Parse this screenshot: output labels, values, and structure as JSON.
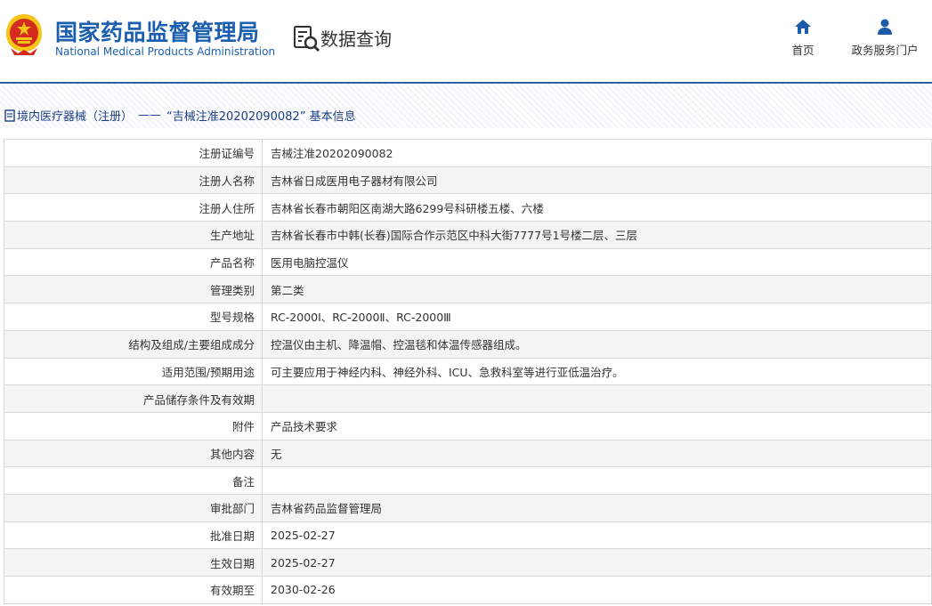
{
  "header": {
    "agency_cn": "国家药品监督管理局",
    "agency_en": "National Medical Products Administration",
    "section_title": "数据查询",
    "nav": {
      "home": "首页",
      "portal": "政务服务门户"
    }
  },
  "breadcrumb": {
    "category": "境内医疗器械（注册）",
    "separator": "——",
    "current": "“吉械注准20202090082” 基本信息"
  },
  "colors": {
    "brand_blue": "#1b5fae",
    "nav_icon_blue": "#1a5aa8",
    "rule_blue": "#2b63a8",
    "emblem_red": "#d52b1e",
    "emblem_gold": "#f5c518"
  },
  "icons": {
    "emblem": "national-emblem-icon",
    "query": "data-query-icon",
    "home": "home-icon",
    "portal": "user-icon",
    "doc": "document-icon"
  },
  "record": [
    {
      "label": "注册证编号",
      "value": "吉械注准20202090082"
    },
    {
      "label": "注册人名称",
      "value": "吉林省日成医用电子器材有限公司"
    },
    {
      "label": "注册人住所",
      "value": "吉林省长春市朝阳区南湖大路6299号科研楼五楼、六楼"
    },
    {
      "label": "生产地址",
      "value": "吉林省长春市中韩(长春)国际合作示范区中科大街7777号1号楼二层、三层"
    },
    {
      "label": "产品名称",
      "value": "医用电脑控温仪"
    },
    {
      "label": "管理类别",
      "value": "第二类"
    },
    {
      "label": "型号规格",
      "value": "RC-2000Ⅰ、RC-2000Ⅱ、RC-2000Ⅲ"
    },
    {
      "label": "结构及组成/主要组成成分",
      "value": "控温仪由主机、降温帽、控温毯和体温传感器组成。"
    },
    {
      "label": "适用范围/预期用途",
      "value": "可主要应用于神经内科、神经外科、ICU、急救科室等进行亚低温治疗。"
    },
    {
      "label": "产品储存条件及有效期",
      "value": ""
    },
    {
      "label": "附件",
      "value": "产品技术要求"
    },
    {
      "label": "其他内容",
      "value": "无"
    },
    {
      "label": "备注",
      "value": ""
    },
    {
      "label": "审批部门",
      "value": "吉林省药品监督管理局"
    },
    {
      "label": "批准日期",
      "value": "2025-02-27"
    },
    {
      "label": "生效日期",
      "value": "2025-02-27"
    },
    {
      "label": "有效期至",
      "value": "2030-02-26"
    }
  ]
}
